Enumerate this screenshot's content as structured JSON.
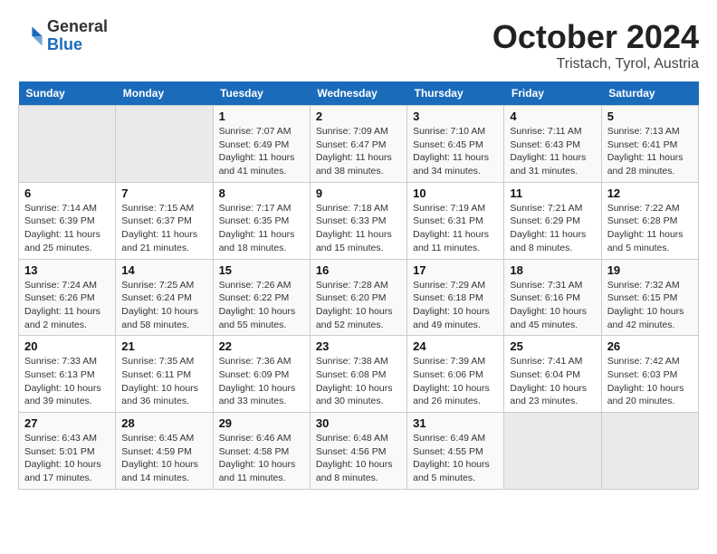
{
  "logo": {
    "general": "General",
    "blue": "Blue"
  },
  "title": "October 2024",
  "subtitle": "Tristach, Tyrol, Austria",
  "weekdays": [
    "Sunday",
    "Monday",
    "Tuesday",
    "Wednesday",
    "Thursday",
    "Friday",
    "Saturday"
  ],
  "weeks": [
    [
      null,
      null,
      {
        "day": "1",
        "sunrise": "7:07 AM",
        "sunset": "6:49 PM",
        "daylight": "11 hours and 41 minutes."
      },
      {
        "day": "2",
        "sunrise": "7:09 AM",
        "sunset": "6:47 PM",
        "daylight": "11 hours and 38 minutes."
      },
      {
        "day": "3",
        "sunrise": "7:10 AM",
        "sunset": "6:45 PM",
        "daylight": "11 hours and 34 minutes."
      },
      {
        "day": "4",
        "sunrise": "7:11 AM",
        "sunset": "6:43 PM",
        "daylight": "11 hours and 31 minutes."
      },
      {
        "day": "5",
        "sunrise": "7:13 AM",
        "sunset": "6:41 PM",
        "daylight": "11 hours and 28 minutes."
      }
    ],
    [
      {
        "day": "6",
        "sunrise": "7:14 AM",
        "sunset": "6:39 PM",
        "daylight": "11 hours and 25 minutes."
      },
      {
        "day": "7",
        "sunrise": "7:15 AM",
        "sunset": "6:37 PM",
        "daylight": "11 hours and 21 minutes."
      },
      {
        "day": "8",
        "sunrise": "7:17 AM",
        "sunset": "6:35 PM",
        "daylight": "11 hours and 18 minutes."
      },
      {
        "day": "9",
        "sunrise": "7:18 AM",
        "sunset": "6:33 PM",
        "daylight": "11 hours and 15 minutes."
      },
      {
        "day": "10",
        "sunrise": "7:19 AM",
        "sunset": "6:31 PM",
        "daylight": "11 hours and 11 minutes."
      },
      {
        "day": "11",
        "sunrise": "7:21 AM",
        "sunset": "6:29 PM",
        "daylight": "11 hours and 8 minutes."
      },
      {
        "day": "12",
        "sunrise": "7:22 AM",
        "sunset": "6:28 PM",
        "daylight": "11 hours and 5 minutes."
      }
    ],
    [
      {
        "day": "13",
        "sunrise": "7:24 AM",
        "sunset": "6:26 PM",
        "daylight": "11 hours and 2 minutes."
      },
      {
        "day": "14",
        "sunrise": "7:25 AM",
        "sunset": "6:24 PM",
        "daylight": "10 hours and 58 minutes."
      },
      {
        "day": "15",
        "sunrise": "7:26 AM",
        "sunset": "6:22 PM",
        "daylight": "10 hours and 55 minutes."
      },
      {
        "day": "16",
        "sunrise": "7:28 AM",
        "sunset": "6:20 PM",
        "daylight": "10 hours and 52 minutes."
      },
      {
        "day": "17",
        "sunrise": "7:29 AM",
        "sunset": "6:18 PM",
        "daylight": "10 hours and 49 minutes."
      },
      {
        "day": "18",
        "sunrise": "7:31 AM",
        "sunset": "6:16 PM",
        "daylight": "10 hours and 45 minutes."
      },
      {
        "day": "19",
        "sunrise": "7:32 AM",
        "sunset": "6:15 PM",
        "daylight": "10 hours and 42 minutes."
      }
    ],
    [
      {
        "day": "20",
        "sunrise": "7:33 AM",
        "sunset": "6:13 PM",
        "daylight": "10 hours and 39 minutes."
      },
      {
        "day": "21",
        "sunrise": "7:35 AM",
        "sunset": "6:11 PM",
        "daylight": "10 hours and 36 minutes."
      },
      {
        "day": "22",
        "sunrise": "7:36 AM",
        "sunset": "6:09 PM",
        "daylight": "10 hours and 33 minutes."
      },
      {
        "day": "23",
        "sunrise": "7:38 AM",
        "sunset": "6:08 PM",
        "daylight": "10 hours and 30 minutes."
      },
      {
        "day": "24",
        "sunrise": "7:39 AM",
        "sunset": "6:06 PM",
        "daylight": "10 hours and 26 minutes."
      },
      {
        "day": "25",
        "sunrise": "7:41 AM",
        "sunset": "6:04 PM",
        "daylight": "10 hours and 23 minutes."
      },
      {
        "day": "26",
        "sunrise": "7:42 AM",
        "sunset": "6:03 PM",
        "daylight": "10 hours and 20 minutes."
      }
    ],
    [
      {
        "day": "27",
        "sunrise": "6:43 AM",
        "sunset": "5:01 PM",
        "daylight": "10 hours and 17 minutes."
      },
      {
        "day": "28",
        "sunrise": "6:45 AM",
        "sunset": "4:59 PM",
        "daylight": "10 hours and 14 minutes."
      },
      {
        "day": "29",
        "sunrise": "6:46 AM",
        "sunset": "4:58 PM",
        "daylight": "10 hours and 11 minutes."
      },
      {
        "day": "30",
        "sunrise": "6:48 AM",
        "sunset": "4:56 PM",
        "daylight": "10 hours and 8 minutes."
      },
      {
        "day": "31",
        "sunrise": "6:49 AM",
        "sunset": "4:55 PM",
        "daylight": "10 hours and 5 minutes."
      },
      null,
      null
    ]
  ]
}
